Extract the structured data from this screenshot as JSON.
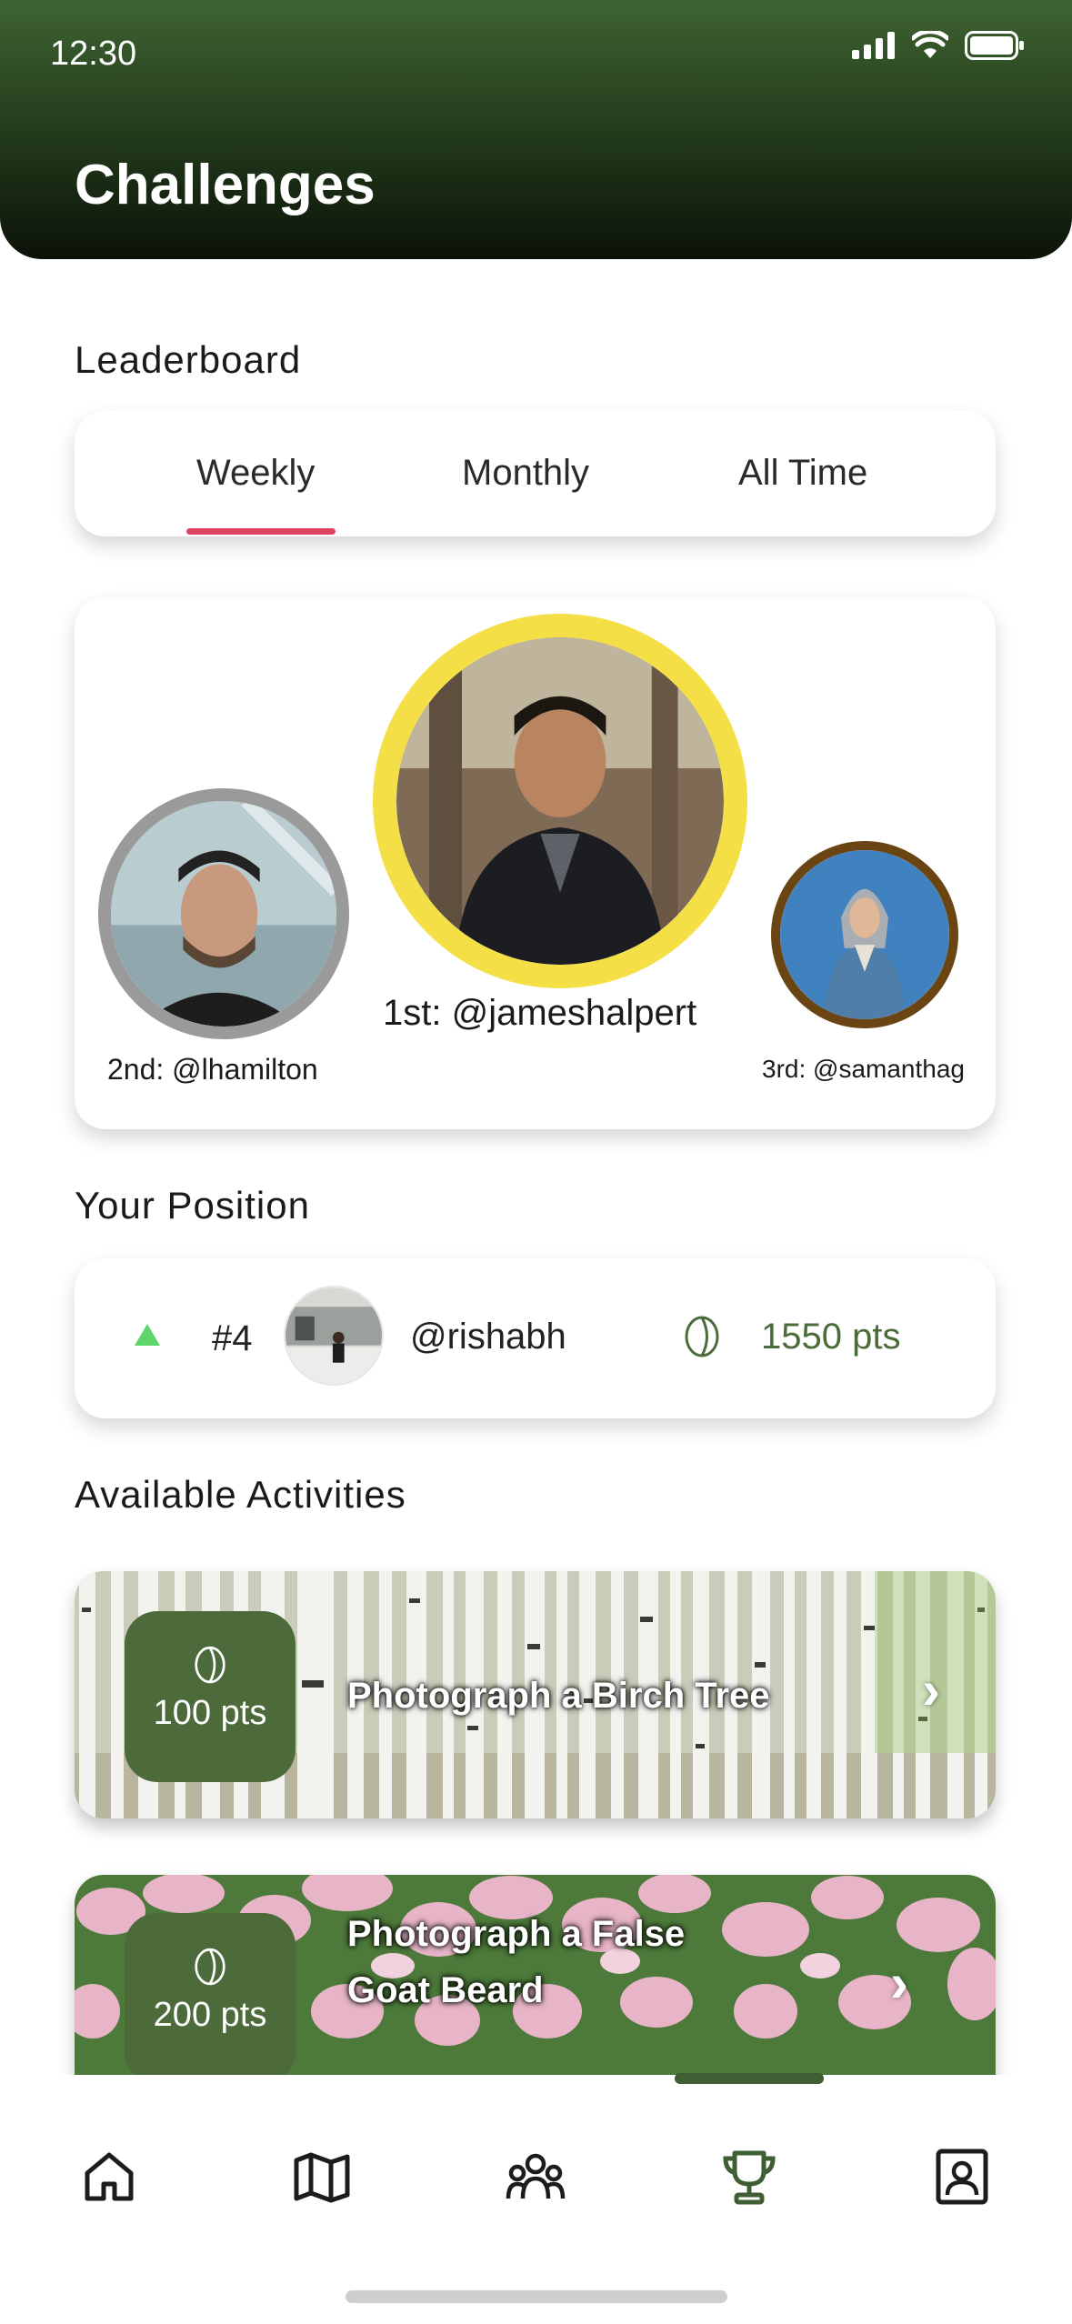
{
  "status": {
    "time": "12:30"
  },
  "header": {
    "title": "Challenges"
  },
  "leaderboard": {
    "label": "Leaderboard",
    "tabs": [
      "Weekly",
      "Monthly",
      "All Time"
    ],
    "active_tab": "Weekly",
    "podium": {
      "first": "1st: @jameshalpert",
      "second": "2nd: @lhamilton",
      "third": "3rd: @samanthag"
    }
  },
  "your_position": {
    "label": "Your Position",
    "trend": "up",
    "rank": "#4",
    "username": "@rishabh",
    "points": "1550 pts"
  },
  "activities": {
    "label": "Available Activities",
    "items": [
      {
        "points": "100 pts",
        "title": "Photograph a Birch Tree"
      },
      {
        "points": "200 pts",
        "title_line1": "Photograph a False",
        "title_line2": "Goat Beard"
      }
    ]
  },
  "nav": {
    "items": [
      "home-icon",
      "map-icon",
      "community-icon",
      "trophy-icon",
      "profile-icon"
    ],
    "active": "trophy-icon"
  },
  "colors": {
    "accent_green": "#4d6a3b",
    "points_green": "#4b6b3a",
    "tab_underline": "#e0415e",
    "gold": "#f5df47",
    "silver": "#9a9a9a",
    "bronze": "#6b4414"
  }
}
